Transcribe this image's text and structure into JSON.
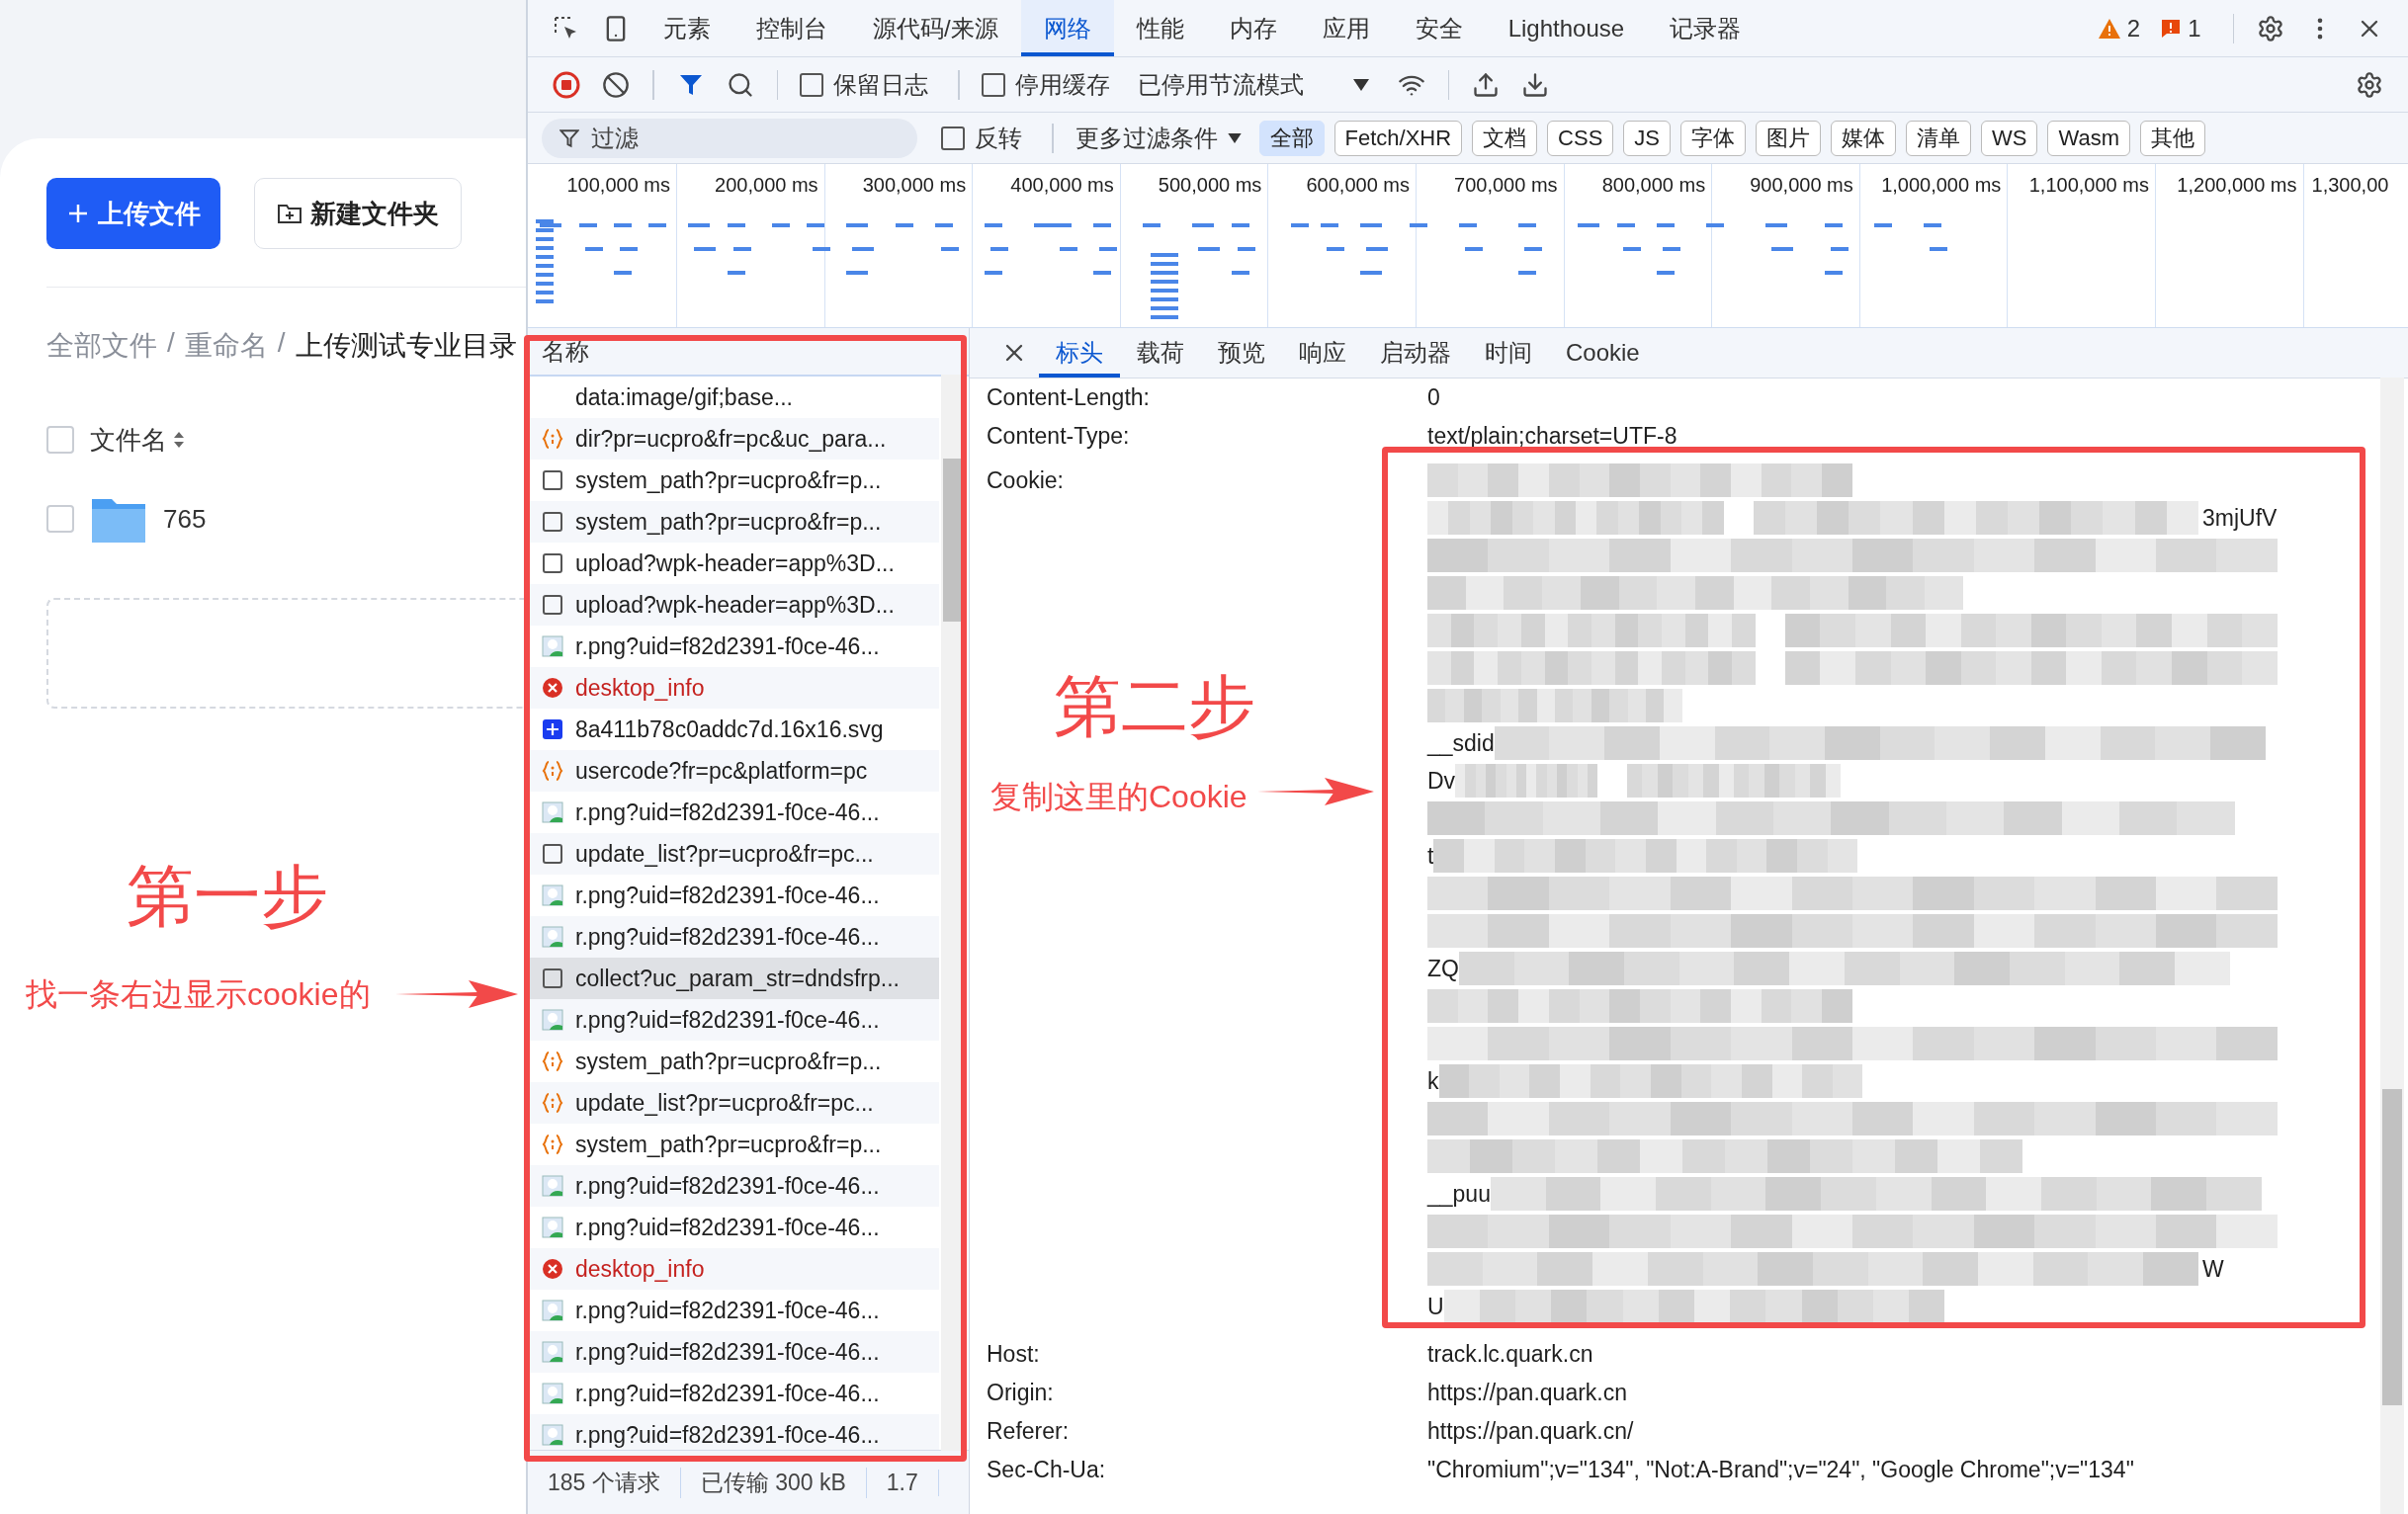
{
  "webpage": {
    "upload_button": "上传文件",
    "new_folder_button": "新建文件夹",
    "separator": "/",
    "breadcrumb": [
      {
        "label": "全部文件",
        "current": false
      },
      {
        "label": "重命名",
        "current": false
      },
      {
        "label": "上传测试专业目录",
        "current": true
      }
    ],
    "file_list": {
      "header": "文件名",
      "header_checked": false,
      "rows": [
        {
          "name": "765",
          "kind": "folder",
          "checked": false
        }
      ]
    }
  },
  "devtools": {
    "panel_tabs": [
      {
        "label": "元素",
        "selected": false
      },
      {
        "label": "控制台",
        "selected": false
      },
      {
        "label": "源代码/来源",
        "selected": false
      },
      {
        "label": "网络",
        "selected": true
      },
      {
        "label": "性能",
        "selected": false
      },
      {
        "label": "内存",
        "selected": false
      },
      {
        "label": "应用",
        "selected": false
      },
      {
        "label": "安全",
        "selected": false
      },
      {
        "label": "Lighthouse",
        "selected": false
      },
      {
        "label": "记录器",
        "selected": false
      }
    ],
    "warnings": "2",
    "issues": "1",
    "toolbar": {
      "recording": true,
      "preserve_log": {
        "label": "保留日志",
        "checked": false
      },
      "disable_cache": {
        "label": "停用缓存",
        "checked": false
      },
      "throttling": "已停用节流模式"
    },
    "filter": {
      "placeholder": "过滤",
      "invert": {
        "label": "反转",
        "checked": false
      },
      "more_filters": "更多过滤条件",
      "types": [
        {
          "label": "全部",
          "selected": true
        },
        {
          "label": "Fetch/XHR",
          "selected": false
        },
        {
          "label": "文档",
          "selected": false
        },
        {
          "label": "CSS",
          "selected": false
        },
        {
          "label": "JS",
          "selected": false
        },
        {
          "label": "字体",
          "selected": false
        },
        {
          "label": "图片",
          "selected": false
        },
        {
          "label": "媒体",
          "selected": false
        },
        {
          "label": "清单",
          "selected": false
        },
        {
          "label": "WS",
          "selected": false
        },
        {
          "label": "Wasm",
          "selected": false
        },
        {
          "label": "其他",
          "selected": false
        }
      ]
    },
    "overview": {
      "ticks": [
        "100,000 ms",
        "200,000 ms",
        "300,000 ms",
        "400,000 ms",
        "500,000 ms",
        "600,000 ms",
        "700,000 ms",
        "800,000 ms",
        "900,000 ms",
        "1,000,000 ms",
        "1,100,000 ms",
        "1,200,000 ms",
        "1,300,00"
      ]
    },
    "requests": {
      "column": "名称",
      "rows": [
        {
          "name": "data:image/gif;base...",
          "kind": "blank",
          "selected": false
        },
        {
          "name": "dir?pr=ucpro&fr=pc&uc_para...",
          "kind": "fetch",
          "selected": false
        },
        {
          "name": "system_path?pr=ucpro&fr=p...",
          "kind": "document",
          "selected": false
        },
        {
          "name": "system_path?pr=ucpro&fr=p...",
          "kind": "document",
          "selected": false
        },
        {
          "name": "upload?wpk-header=app%3D...",
          "kind": "document",
          "selected": false
        },
        {
          "name": "upload?wpk-header=app%3D...",
          "kind": "document",
          "selected": false
        },
        {
          "name": "r.png?uid=f82d2391-f0ce-46...",
          "kind": "image",
          "selected": false
        },
        {
          "name": "desktop_info",
          "kind": "error",
          "selected": false
        },
        {
          "name": "8a411b78c0addc7d.16x16.svg",
          "kind": "script",
          "selected": false
        },
        {
          "name": "usercode?fr=pc&platform=pc",
          "kind": "fetch",
          "selected": false
        },
        {
          "name": "r.png?uid=f82d2391-f0ce-46...",
          "kind": "image",
          "selected": false
        },
        {
          "name": "update_list?pr=ucpro&fr=pc...",
          "kind": "document",
          "selected": false
        },
        {
          "name": "r.png?uid=f82d2391-f0ce-46...",
          "kind": "image",
          "selected": false
        },
        {
          "name": "r.png?uid=f82d2391-f0ce-46...",
          "kind": "image",
          "selected": false
        },
        {
          "name": "collect?uc_param_str=dndsfrp...",
          "kind": "document",
          "selected": true
        },
        {
          "name": "r.png?uid=f82d2391-f0ce-46...",
          "kind": "image",
          "selected": false
        },
        {
          "name": "system_path?pr=ucpro&fr=p...",
          "kind": "fetch",
          "selected": false
        },
        {
          "name": "update_list?pr=ucpro&fr=pc...",
          "kind": "fetch",
          "selected": false
        },
        {
          "name": "system_path?pr=ucpro&fr=p...",
          "kind": "fetch",
          "selected": false
        },
        {
          "name": "r.png?uid=f82d2391-f0ce-46...",
          "kind": "image",
          "selected": false
        },
        {
          "name": "r.png?uid=f82d2391-f0ce-46...",
          "kind": "image",
          "selected": false
        },
        {
          "name": "desktop_info",
          "kind": "error",
          "selected": false
        },
        {
          "name": "r.png?uid=f82d2391-f0ce-46...",
          "kind": "image",
          "selected": false
        },
        {
          "name": "r.png?uid=f82d2391-f0ce-46...",
          "kind": "image",
          "selected": false
        },
        {
          "name": "r.png?uid=f82d2391-f0ce-46...",
          "kind": "image",
          "selected": false
        },
        {
          "name": "r.png?uid=f82d2391-f0ce-46...",
          "kind": "image",
          "selected": false
        }
      ]
    },
    "status_bar": [
      "185 个请求",
      "已传输 300 kB",
      "1.7"
    ],
    "details": {
      "tabs": [
        {
          "label": "标头",
          "selected": true
        },
        {
          "label": "载荷",
          "selected": false
        },
        {
          "label": "预览",
          "selected": false
        },
        {
          "label": "响应",
          "selected": false
        },
        {
          "label": "启动器",
          "selected": false
        },
        {
          "label": "时间",
          "selected": false
        },
        {
          "label": "Cookie",
          "selected": false
        }
      ],
      "headers": [
        {
          "kind": "text",
          "name": "Content-Length:",
          "value": "0"
        },
        {
          "kind": "text",
          "name": "Content-Type:",
          "value": "text/plain;charset=UTF-8"
        },
        {
          "kind": "cookie",
          "name": "Cookie:",
          "lines": [
            {
              "kind": "masked"
            },
            {
              "kind": "masked",
              "suffix": "3mjUfV"
            },
            {
              "kind": "masked"
            },
            {
              "kind": "masked"
            },
            {
              "kind": "masked"
            },
            {
              "kind": "masked"
            },
            {
              "kind": "masked"
            },
            {
              "kind": "masked",
              "prefix": "__sdid"
            },
            {
              "kind": "masked",
              "prefix": "Dv"
            },
            {
              "kind": "masked"
            },
            {
              "kind": "masked",
              "prefix": "t"
            },
            {
              "kind": "masked"
            },
            {
              "kind": "masked"
            },
            {
              "kind": "masked",
              "prefix": "ZQ"
            },
            {
              "kind": "masked"
            },
            {
              "kind": "masked"
            },
            {
              "kind": "masked",
              "prefix": "k"
            },
            {
              "kind": "masked"
            },
            {
              "kind": "masked"
            },
            {
              "kind": "masked",
              "prefix": "__puu"
            },
            {
              "kind": "masked"
            },
            {
              "kind": "masked",
              "suffix": "W"
            },
            {
              "kind": "masked",
              "prefix": "U"
            }
          ]
        },
        {
          "kind": "text",
          "name": "Host:",
          "value": "track.lc.quark.cn"
        },
        {
          "kind": "text",
          "name": "Origin:",
          "value": "https://pan.quark.cn"
        },
        {
          "kind": "text",
          "name": "Referer:",
          "value": "https://pan.quark.cn/"
        },
        {
          "kind": "text",
          "name": "Sec-Ch-Ua:",
          "value": "\"Chromium\";v=\"134\", \"Not:A-Brand\";v=\"24\", \"Google Chrome\";v=\"134\""
        }
      ]
    }
  },
  "annotations": {
    "step_one": {
      "title": "第一步",
      "note": "找一条右边显示cookie的"
    },
    "step_two": {
      "title": "第二步",
      "note": "复制这里的Cookie"
    }
  }
}
